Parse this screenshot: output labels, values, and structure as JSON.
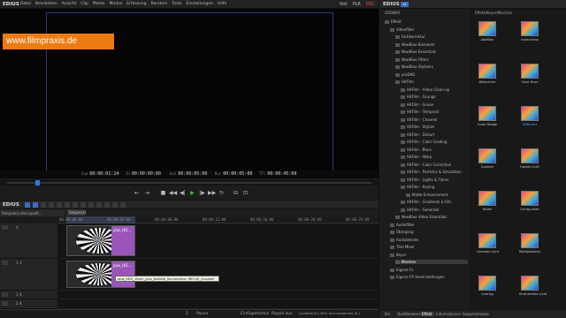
{
  "menubar": {
    "app": "EDIUS",
    "items": [
      "Datei",
      "Bearbeiten",
      "Ansicht",
      "Clip",
      "Marke",
      "Modus",
      "Erfassung",
      "Rendern",
      "Tools",
      "Einstellungen",
      "Hilfe"
    ],
    "right_mode": "Voll",
    "plr": "PLR",
    "rec": "REC"
  },
  "watermark": "www.filmpraxis.de",
  "timecodes": {
    "cue_label": "Cue",
    "cue": "00:00:01:14",
    "in_label": "In",
    "in": "00:00:00:00",
    "out_label": "Out",
    "out": "00:00:05:00",
    "dur_label": "Dur",
    "dur": "00:00:05:00",
    "ttl_label": "TTl",
    "ttl": "00:00:45:09"
  },
  "timeline": {
    "app": "EDIUS",
    "tab": "filmpraxis-drei-qualit...",
    "sequence": "Sequenz1",
    "ruler": [
      "00:00:00:00",
      "00:00:04:00",
      "00:00:08:00",
      "00:00:12:00",
      "00:00:16:00",
      "00:00:20:00",
      "00:00:24:00"
    ],
    "tracks": [
      {
        "name": "V",
        "sub": "Rg"
      },
      {
        "name": "1 V",
        "sub": "TC"
      },
      {
        "name": "1 A",
        "sub": ""
      },
      {
        "name": "2 A",
        "sub": ""
      }
    ],
    "clip_label_1": "plus_HD...",
    "clip_label_2": "plus_HD...",
    "tooltip": "plus_HDV_10sch_plus_testbild_Sonnenstern IRE100_Graukeil"
  },
  "statusbar": {
    "pause": "Pause",
    "track_num": "2",
    "insert_mode": "Einfügemodus",
    "ripple": "Ripple aus",
    "drive": "Laufwerk(D:) 64% wird verwendet (E:)"
  },
  "rpanel": {
    "app": "EDIUS",
    "fx": "fx",
    "folder_label": "ORDNER",
    "crumb": "Effekt/Keyer/Mischen",
    "tree": [
      {
        "label": "Effekt",
        "level": 0
      },
      {
        "label": "Videofilter",
        "level": 1
      },
      {
        "label": "Farbkorrektur",
        "level": 2
      },
      {
        "label": "NewBlue Elements",
        "level": 2
      },
      {
        "label": "NewBlue Essentials",
        "level": 2
      },
      {
        "label": "NewBlue Filters",
        "level": 2
      },
      {
        "label": "NewBlue Stylizers",
        "level": 2
      },
      {
        "label": "proDAD",
        "level": 2
      },
      {
        "label": "HitFilm",
        "level": 2
      },
      {
        "label": "HitFilm - Video Clean-up",
        "level": 3
      },
      {
        "label": "HitFilm - Grunge",
        "level": 3
      },
      {
        "label": "HitFilm - Scene",
        "level": 3
      },
      {
        "label": "HitFilm - Temporal",
        "level": 3
      },
      {
        "label": "HitFilm - Channel",
        "level": 3
      },
      {
        "label": "HitFilm - Stylize",
        "level": 3
      },
      {
        "label": "HitFilm - Distort",
        "level": 3
      },
      {
        "label": "HitFilm - Color Grading",
        "level": 3
      },
      {
        "label": "HitFilm - Blurs",
        "level": 3
      },
      {
        "label": "HitFilm - Warp",
        "level": 3
      },
      {
        "label": "HitFilm - Color Correction",
        "level": 3
      },
      {
        "label": "HitFilm - Particles & Simulation",
        "level": 3
      },
      {
        "label": "HitFilm - Lights & Flares",
        "level": 3
      },
      {
        "label": "HitFilm - Keying",
        "level": 3
      },
      {
        "label": "Matte Enhancement",
        "level": 4
      },
      {
        "label": "HitFilm - Gradients & Fills",
        "level": 3
      },
      {
        "label": "HitFilm - Generate",
        "level": 3
      },
      {
        "label": "NewBlue Video Essentials",
        "level": 2
      },
      {
        "label": "Audiofilter",
        "level": 1
      },
      {
        "label": "Übergang",
        "level": 1
      },
      {
        "label": "Audioblende",
        "level": 1
      },
      {
        "label": "Titel Mixer",
        "level": 1
      },
      {
        "label": "Keyer",
        "level": 1
      },
      {
        "label": "Mischen",
        "level": 2,
        "selected": true
      },
      {
        "label": "Eigene Fx",
        "level": 1
      },
      {
        "label": "Eigene FX Voreinstellungen",
        "level": 1
      }
    ],
    "effects": [
      "Addition",
      "Ausschluss",
      "Bildschirm",
      "Color Burn",
      "Color Dodge",
      "Differenz",
      "Dunkler",
      "Hartes Licht",
      "Heller",
      "Lichtpunkte",
      "Lineares Licht",
      "Multiplizieren",
      "Overlay",
      "Strahlendes Licht"
    ],
    "selected_effect": "Differenz",
    "tabs": [
      "Bin",
      "Quellbrowser",
      "Effekt",
      "Informationen",
      "Sequenzmarke"
    ],
    "active_tab": "Effekt"
  }
}
